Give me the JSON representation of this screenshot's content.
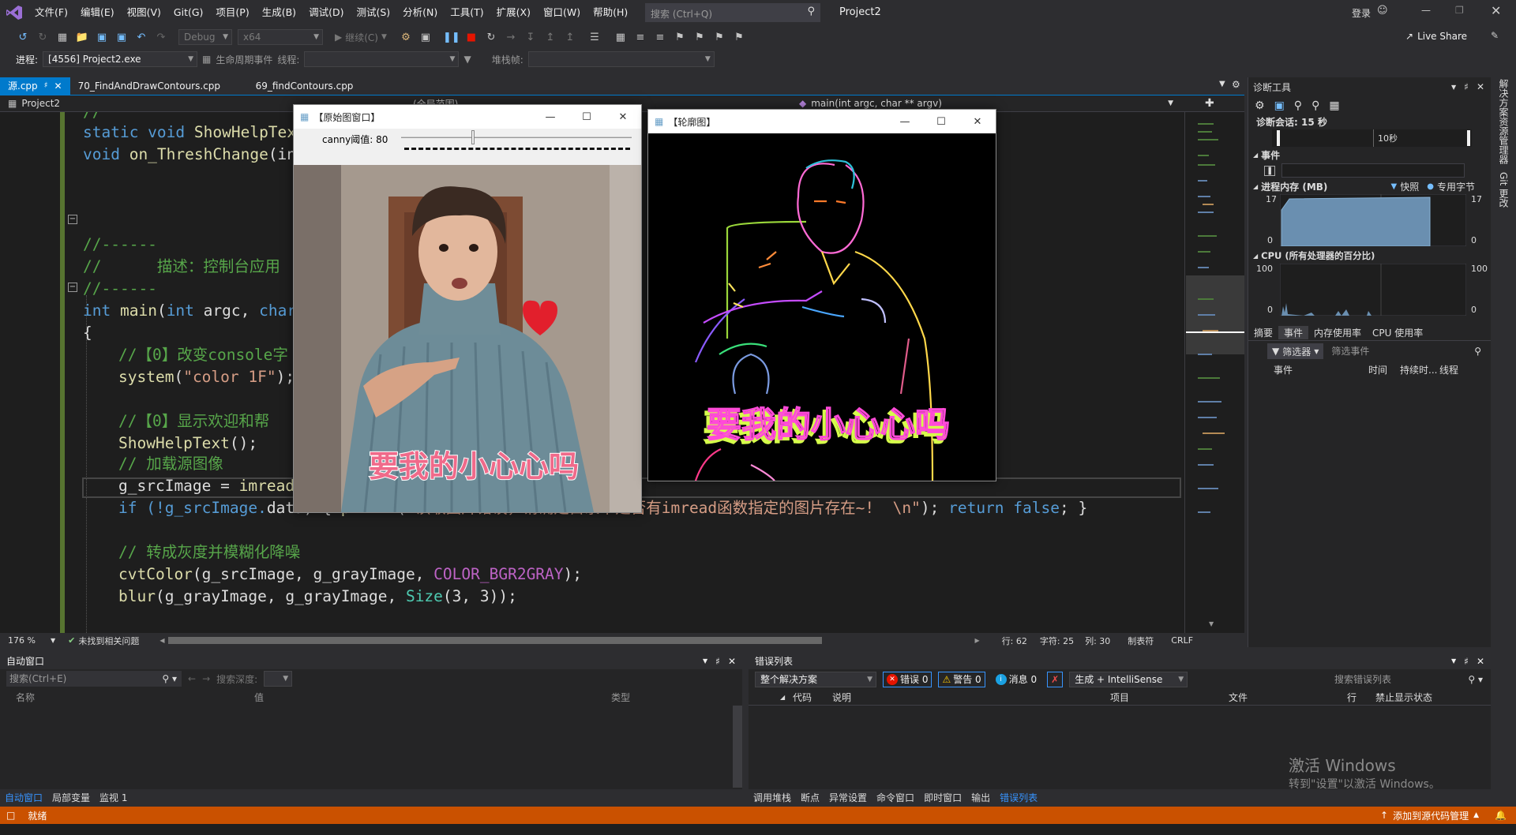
{
  "menu": {
    "items": [
      "文件(F)",
      "编辑(E)",
      "视图(V)",
      "Git(G)",
      "项目(P)",
      "生成(B)",
      "调试(D)",
      "测试(S)",
      "分析(N)",
      "工具(T)",
      "扩展(X)",
      "窗口(W)",
      "帮助(H)"
    ],
    "search_placeholder": "搜索 (Ctrl+Q)",
    "project": "Project2",
    "signin": "登录"
  },
  "toolbar": {
    "config": "Debug",
    "platform": "x64",
    "continue": "继续(C)",
    "live_share": "Live Share"
  },
  "toolbar2": {
    "process_label": "进程:",
    "process_value": "[4556] Project2.exe",
    "lifecycle": "生命周期事件",
    "thread_label": "线程:",
    "stackframe_label": "堆栈帧:"
  },
  "tabs": [
    {
      "label": "源.cpp",
      "active": true
    },
    {
      "label": "70_FindAndDrawContours.cpp",
      "active": false
    },
    {
      "label": "69_findContours.cpp",
      "active": false
    }
  ],
  "navbar": {
    "project": "Project2",
    "scope": "(全局范围)",
    "function": "main(int argc, char ** argv)"
  },
  "code": {
    "l1": "//",
    "l2a": "static void ",
    "l2b": "ShowHelpText",
    "l3a": "void ",
    "l3b": "on_ThreshChange",
    "l3c": "(in",
    "l4": "//------",
    "l5": "//      描述：控制台应用",
    "l6": "//------",
    "l7a": "int ",
    "l7b": "main",
    "l7c": "(",
    "l7d": "int",
    "l7e": " argc, ",
    "l7f": "char",
    "l8": "{",
    "l9": "//【0】改变console字",
    "l10a": "system",
    "l10b": "(",
    "l10c": "\"color 1F\"",
    "l10d": ");",
    "l11": "//【0】显示欢迎和帮",
    "l12a": "ShowHelpText",
    "l12b": "();",
    "l13": "// 加载源图像",
    "l14a": "g_srcImage = ",
    "l14b": "imread",
    "l15a": "if (!g_srcImage.",
    "l15b": "data",
    "l15c": ") { ",
    "l15d": "printf",
    "l15e": "(",
    "l15f": "\"读取图片错误，请确定目录下是否有imread函数指定的图片存在~!  \\n\"",
    "l15g": "); ",
    "l15h": "return",
    "l15i": " ",
    "l15j": "false",
    "l15k": "; }",
    "l16": "// 转成灰度并模糊化降噪",
    "l17a": "cvtColor",
    "l17b": "(g_srcImage, g_grayImage, ",
    "l17c": "COLOR_BGR2GRAY",
    "l17d": ");",
    "l18a": "blur",
    "l18b": "(g_grayImage, g_grayImage, ",
    "l18c": "Size",
    "l18d": "(3, 3));"
  },
  "editor_status": {
    "zoom": "176 %",
    "issues": "未找到相关问题",
    "line": "行: 62",
    "char": "字符: 25",
    "col": "列: 30",
    "tabs": "制表符",
    "eol": "CRLF"
  },
  "window_src": {
    "title": "【原始图窗口】",
    "slider_label": "canny阈值: 80",
    "slider_value": 0.31,
    "caption": "要我的小心心吗"
  },
  "window_contour": {
    "title": "【轮廓图】",
    "caption": "要我的小心心吗"
  },
  "diag": {
    "title": "诊断工具",
    "session": "诊断会话: 15 秒",
    "timeline_label": "10秒",
    "events_section": "事件",
    "memory_section": "进程内存 (MB)",
    "legend_snapshot": "快照",
    "legend_private": "专用字节",
    "mem_max_left": "17",
    "mem_max_right": "17",
    "mem_min_left": "0",
    "mem_min_right": "0",
    "cpu_section": "CPU (所有处理器的百分比)",
    "cpu_max_left": "100",
    "cpu_max_right": "100",
    "cpu_min_left": "0",
    "cpu_min_right": "0",
    "tabs": [
      "摘要",
      "事件",
      "内存使用率",
      "CPU 使用率"
    ],
    "filter": "筛选器",
    "filter_placeholder": "筛选事件",
    "columns": [
      "事件",
      "时间",
      "持续时...",
      "线程"
    ]
  },
  "side_tabs": [
    "解决方案资源管理器",
    "Git 更改"
  ],
  "auto_window": {
    "title": "自动窗口",
    "search_placeholder": "搜索(Ctrl+E)",
    "search_depth": "搜索深度:",
    "columns": [
      "名称",
      "值",
      "类型"
    ],
    "bottom_tabs": [
      "自动窗口",
      "局部变量",
      "监视 1"
    ]
  },
  "error_list": {
    "title": "错误列表",
    "scope": "整个解决方案",
    "errors": "错误 0",
    "warnings": "警告 0",
    "messages": "消息 0",
    "build": "生成 + IntelliSense",
    "search_placeholder": "搜索错误列表",
    "columns": [
      "代码",
      "说明",
      "项目",
      "文件",
      "行",
      "禁止显示状态"
    ],
    "bottom_tabs": [
      "调用堆栈",
      "断点",
      "异常设置",
      "命令窗口",
      "即时窗口",
      "输出",
      "错误列表"
    ]
  },
  "watermark": {
    "line1": "激活 Windows",
    "line2": "转到\"设置\"以激活 Windows。"
  },
  "statusbar": {
    "ready": "就绪",
    "source_control": "添加到源代码管理"
  }
}
